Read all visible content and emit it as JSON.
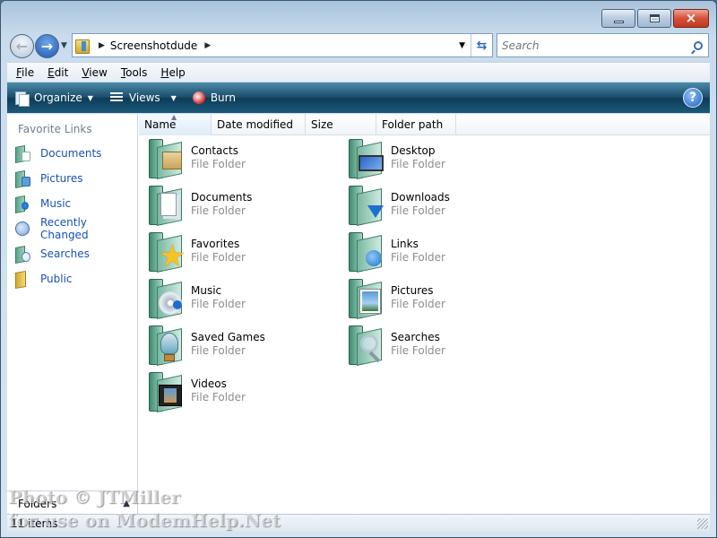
{
  "window": {
    "caption_buttons": {
      "minimize": "minimize",
      "maximize": "maximize",
      "close": "×"
    }
  },
  "address": {
    "path": "Screenshotdude",
    "icon": "folder-user-icon"
  },
  "search": {
    "placeholder": "Search"
  },
  "menu": [
    {
      "label": "File",
      "accel": "F",
      "rest": "ile"
    },
    {
      "label": "Edit",
      "accel": "E",
      "rest": "dit"
    },
    {
      "label": "View",
      "accel": "V",
      "rest": "iew"
    },
    {
      "label": "Tools",
      "accel": "T",
      "rest": "ools"
    },
    {
      "label": "Help",
      "accel": "H",
      "rest": "elp"
    }
  ],
  "toolbar": {
    "organize": "Organize",
    "views": "Views",
    "burn": "Burn",
    "help": "?"
  },
  "sidebar": {
    "title": "Favorite Links",
    "items": [
      {
        "label": "Documents",
        "icon": "documents-icon"
      },
      {
        "label": "Pictures",
        "icon": "pictures-icon"
      },
      {
        "label": "Music",
        "icon": "music-icon"
      },
      {
        "label": "Recently Changed",
        "icon": "recently-changed-icon"
      },
      {
        "label": "Searches",
        "icon": "searches-icon"
      },
      {
        "label": "Public",
        "icon": "public-folder-icon"
      }
    ],
    "folders_label": "Folders"
  },
  "columns": [
    "Name",
    "Date modified",
    "Size",
    "Folder path"
  ],
  "items": [
    {
      "name": "Contacts",
      "type": "File Folder",
      "icon": "contacts-folder-icon"
    },
    {
      "name": "Desktop",
      "type": "File Folder",
      "icon": "desktop-folder-icon"
    },
    {
      "name": "Documents",
      "type": "File Folder",
      "icon": "documents-folder-icon"
    },
    {
      "name": "Downloads",
      "type": "File Folder",
      "icon": "downloads-folder-icon"
    },
    {
      "name": "Favorites",
      "type": "File Folder",
      "icon": "favorites-folder-icon"
    },
    {
      "name": "Links",
      "type": "File Folder",
      "icon": "links-folder-icon"
    },
    {
      "name": "Music",
      "type": "File Folder",
      "icon": "music-folder-icon"
    },
    {
      "name": "Pictures",
      "type": "File Folder",
      "icon": "pictures-folder-icon"
    },
    {
      "name": "Saved Games",
      "type": "File Folder",
      "icon": "saved-games-folder-icon"
    },
    {
      "name": "Searches",
      "type": "File Folder",
      "icon": "searches-folder-icon"
    },
    {
      "name": "Videos",
      "type": "File Folder",
      "icon": "videos-folder-icon"
    }
  ],
  "status": {
    "count": "11 items"
  },
  "watermark": {
    "line1": "Photo © JTMiller",
    "line2": "for use on ModemHelp.Net"
  }
}
